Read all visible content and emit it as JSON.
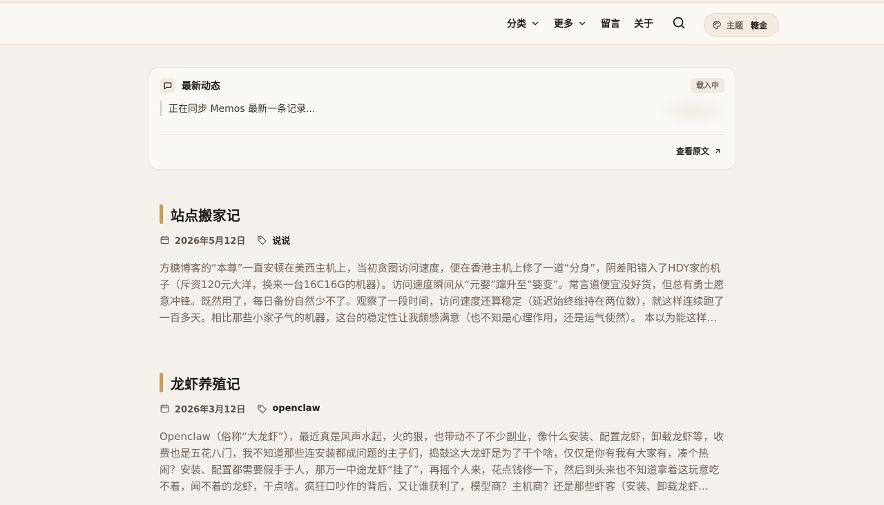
{
  "header": {
    "nav": {
      "categories_label": "分类",
      "more_label": "更多",
      "guestbook_label": "留言",
      "about_label": "关于"
    },
    "theme": {
      "label": "主题",
      "value": "糖金"
    },
    "icons": {
      "search": "search-icon",
      "chevron": "chevron-down-icon",
      "palette": "palette-icon"
    }
  },
  "memos": {
    "title": "最新动态",
    "status_badge": "载入中",
    "sync_text": "正在同步 Memos 最新一条记录...",
    "view_original_label": "查看原文",
    "icons": {
      "title": "message-square-icon",
      "link": "arrow-up-right-icon"
    }
  },
  "posts": [
    {
      "title": "站点搬家记",
      "date": "2026年5月12日",
      "tag": "说说",
      "excerpt": "方糖博客的“本尊”一直安顿在美西主机上，当初贪图访问速度，便在香港主机上修了一道“分身”，阴差阳错入了HDY家的机子（斥资120元大洋，换来一台16C16G的机器）。访问速度瞬间从“元婴”蹿升至“婴变”。常言道便宜没好货，但总有勇士愿意冲锋。既然用了，每日备份自然少不了。观察了一段时间，访问速度还算稳定（延迟始终维持在两位数），就这样连续跑了一百多天。相比那些小家子气的机器，这台的稳定性让我颇感满意（也不知是心理作用，还是运气使然）。 本以为能这样一直用下去……"
    },
    {
      "title": "龙虾养殖记",
      "date": "2026年3月12日",
      "tag": "openclaw",
      "excerpt": "Openclaw（俗称“大龙虾”），最近真是风声水起，火的狠，也带动不了不少副业，像什么安装、配置龙虾，卸载龙虾等，收费也是五花八门，我不知道那些连安装都成问题的主子们，捣鼓这大龙虾是为了干个啥，仅仅是你有我有大家有，凑个热闹？安装、配置都需要假手于人，那万一中途龙虾“挂了”，再摇个人来，花点钱修一下，然后到头来也不知道拿着这玩意吃不着，闻不着的龙虾，干点啥。疯狂口吵作的背后，又让谁获利了，模型商？主机商？还是那些虾客（安装、卸载龙虾的……"
    }
  ],
  "post_icons": {
    "date": "calendar-icon",
    "tag": "tag-icon"
  },
  "colors": {
    "background": "#f4f1ec",
    "header_background": "#fbf7f2",
    "title_accent": "#c79a61",
    "text_primary": "#1f1a15",
    "text_secondary": "#6e645b"
  }
}
